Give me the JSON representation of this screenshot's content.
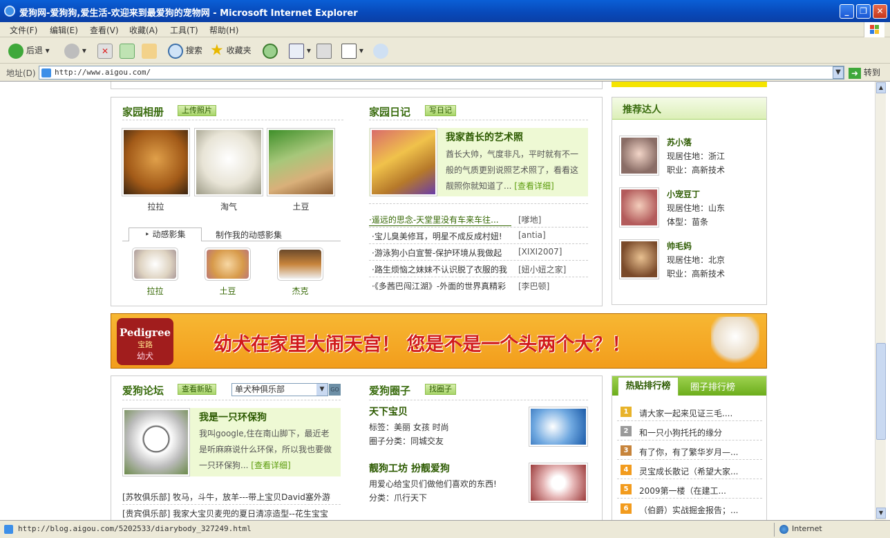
{
  "window": {
    "title": "爱狗网-爱狗狗,爱生活-欢迎来到最爱狗的宠物网 - Microsoft Internet Explorer"
  },
  "menu": [
    "文件(F)",
    "编辑(E)",
    "查看(V)",
    "收藏(A)",
    "工具(T)",
    "帮助(H)"
  ],
  "toolbar": {
    "back": "后退",
    "search": "搜索",
    "favorites": "收藏夹"
  },
  "address": {
    "label": "地址(D)",
    "url": "http://www.aigou.com/",
    "go": "转到"
  },
  "album": {
    "title": "家园相册",
    "upload": "上传照片",
    "photos": [
      "拉拉",
      "淘气",
      "土豆"
    ],
    "tab_active": "动感影集",
    "tab_other": "制作我的动感影集",
    "videos": [
      "拉拉",
      "土豆",
      "杰克"
    ]
  },
  "diary": {
    "title": "家园日记",
    "write": "写日记",
    "feature_title": "我家酋长的艺术照",
    "feature_text": "酋长大帅，气度非凡，平时就有不一般的气质更别说照艺术照了，看看这靓照你就知道了...",
    "more": "[查看详细]",
    "items": [
      {
        "text": "·遥远的思念-天堂里没有车来车往...",
        "author": "[嗲地]"
      },
      {
        "text": "·宝儿臭美修耳，明星不成反成村妞!",
        "author": "[antia]"
      },
      {
        "text": "·游泳狗小白宣誓-保护环境从我做起",
        "author": "[XIXI2007]"
      },
      {
        "text": "·路生烦恼之妹妹不认识脱了衣服的我",
        "author": "[妞小妞之家]"
      },
      {
        "text": "·《多茜巴闯江湖》-外面的世界真精彩",
        "author": "[李巴顿]"
      }
    ]
  },
  "recommend": {
    "title": "推荐达人",
    "people": [
      {
        "name": "苏小落",
        "l1": "现居住地：浙江",
        "l2": "职业：高新技术"
      },
      {
        "name": "小宠豆丁",
        "l1": "现居住地：山东",
        "l2": "体型：苗条"
      },
      {
        "name": "帅毛妈",
        "l1": "现居住地：北京",
        "l2": "职业：高新技术"
      }
    ]
  },
  "banner": {
    "brand": "Pedigree",
    "brand_cn": "宝路",
    "sub": "幼犬",
    "text": "幼犬在家里大闹天宫！ 您是不是一个头两个大？！"
  },
  "forum": {
    "title": "爱狗论坛",
    "new_post": "查看新贴",
    "select": "单犬种俱乐部",
    "go": "GO",
    "feature_title": "我是一只环保狗",
    "feature_text": "我叫google,住在南山脚下，最近老是听麻麻说什么环保，所以我也要做一只环保狗...",
    "more": "[查看详细]",
    "items": [
      "[苏牧俱乐部] 牧马，斗牛，放羊---带上宝贝David塞外游",
      "[贵宾俱乐部] 我家大宝贝麦兜的夏日清凉造型--花生宝宝"
    ]
  },
  "circle": {
    "title": "爱狗圈子",
    "find": "找圈子",
    "groups": [
      {
        "name": "天下宝贝",
        "l1": "标签：美丽 女孩 时尚",
        "l2": "圈子分类：同城交友"
      },
      {
        "name": "靓狗工坊 扮靓爱狗",
        "l1": "用爱心给宝贝们做他们喜欢的东西!",
        "l2": "分类：爪行天下"
      }
    ]
  },
  "ranking": {
    "tab_active": "热贴排行榜",
    "tab_other": "圈子排行榜",
    "items": [
      "请大家一起来见证三毛....",
      "和一只小狗托托的缘分",
      "有了你，有了繁华岁月—...",
      "灵宝成长散记（希望大家...",
      "2009第一楼（在建工...",
      "（伯爵）实战掘金报告；..."
    ],
    "numbers": [
      "1",
      "2",
      "3",
      "4",
      "5",
      "6"
    ]
  },
  "status": {
    "url": "http://blog.aigou.com/5202533/diarybody_327249.html",
    "zone": "Internet"
  }
}
